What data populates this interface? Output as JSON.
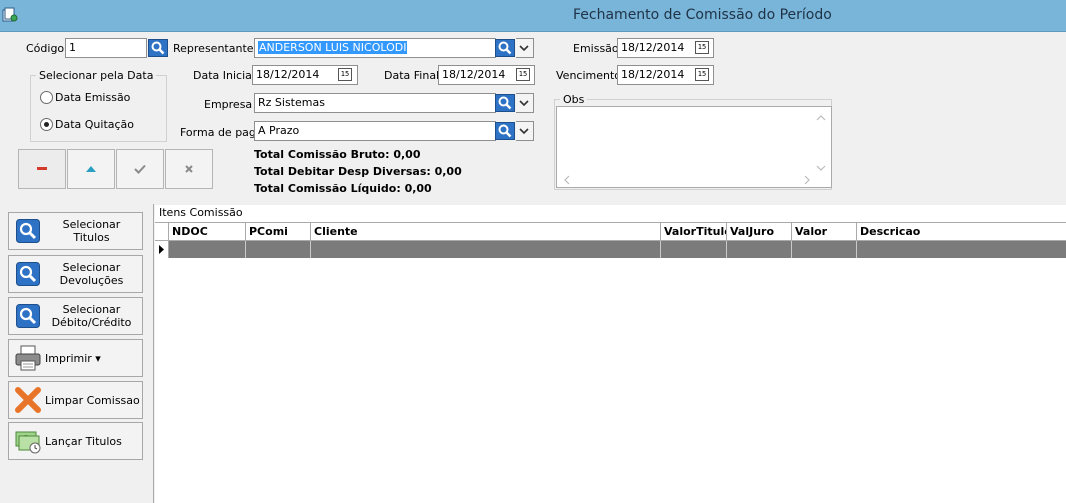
{
  "window": {
    "title": "Fechamento de Comissão do Período"
  },
  "form": {
    "codigo_label": "Código",
    "codigo_value": "1",
    "representante_label": "Representante",
    "representante_value": "ANDERSON LUIS NICOLODI",
    "emissao_label": "Emissão",
    "emissao_value": "18/12/2014",
    "data_inicial_label": "Data Inicial",
    "data_inicial_value": "18/12/2014",
    "data_final_label": "Data Final",
    "data_final_value": "18/12/2014",
    "vencimento_label": "Vencimento",
    "vencimento_value": "18/12/2014",
    "empresa_label": "Empresa",
    "empresa_value": "Rz Sistemas",
    "forma_pag_label": "Forma de pag",
    "forma_pag_value": "A Prazo",
    "obs_label": "Obs",
    "calendar_glyph": "15"
  },
  "date_group": {
    "legend": "Selecionar pela Data",
    "options": [
      {
        "label": "Data Emissão",
        "selected": false
      },
      {
        "label": "Data Quitação",
        "selected": true
      }
    ]
  },
  "totals": {
    "bruto": "Total Comissão Bruto: 0,00",
    "debitar": "Total Debitar Desp Diversas: 0,00",
    "liquido": "Total Comissão Líquido: 0,00"
  },
  "nav_buttons": [
    "minus-icon",
    "up-triangle-icon",
    "check-icon",
    "x-icon"
  ],
  "actions": [
    {
      "label": "Selecionar Titulos",
      "icon": "search-icon"
    },
    {
      "label": "Selecionar Devoluções",
      "icon": "search-icon"
    },
    {
      "label": "Selecionar Débito/Crédito",
      "icon": "search-icon"
    },
    {
      "label": "Imprimir ▾",
      "icon": "printer-icon"
    },
    {
      "label": "Limpar Comissao",
      "icon": "clear-x-icon"
    },
    {
      "label": "Lançar Titulos",
      "icon": "money-icon"
    }
  ],
  "grid": {
    "caption": "Itens Comissão",
    "columns": [
      "NDOC",
      "PComi",
      "Cliente",
      "ValorTitulo",
      "ValJuro",
      "Valor",
      "Descricao"
    ],
    "rows": [
      [
        "",
        "",
        "",
        "",
        "",
        "",
        ""
      ]
    ]
  },
  "colors": {
    "titlebar": "#79b4d9",
    "selection": "#3399ff",
    "search_button": "#2d72c4",
    "selected_row": "#7b7b7b"
  }
}
